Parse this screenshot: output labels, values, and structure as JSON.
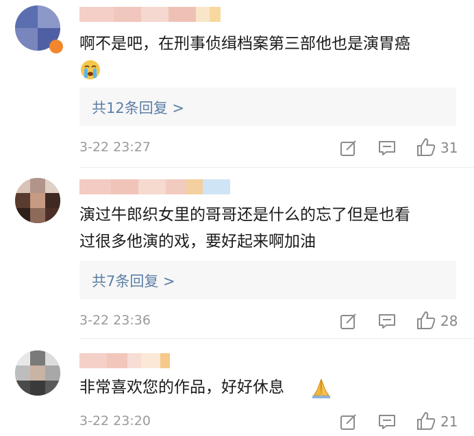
{
  "comments": [
    {
      "text_lines": [
        "啊不是吧，在刑事侦缉档案第三部他也是演胃癌"
      ],
      "emoji": "crying-face",
      "reply_label": "共12条回复 >",
      "timestamp": "3-22 23:27",
      "likes": "31"
    },
    {
      "text_lines": [
        "演过牛郎织女里的哥哥还是什么的忘了但是也看",
        "过很多他演的戏，要好起来啊加油"
      ],
      "emoji": "",
      "reply_label": "共7条回复 >",
      "timestamp": "3-22 23:36",
      "likes": "28"
    },
    {
      "text_lines": [
        "非常喜欢您的作品，好好休息"
      ],
      "emoji": "folded-hands",
      "reply_label": "",
      "timestamp": "3-22 23:20",
      "likes": "21"
    }
  ],
  "colors": {
    "link": "#5b7ea6",
    "meta": "#9a9a9a",
    "reply_bg": "#f7f7f7"
  },
  "icons": {
    "share": "edit-share-icon",
    "comment": "comment-icon",
    "like": "thumbs-up-icon"
  }
}
